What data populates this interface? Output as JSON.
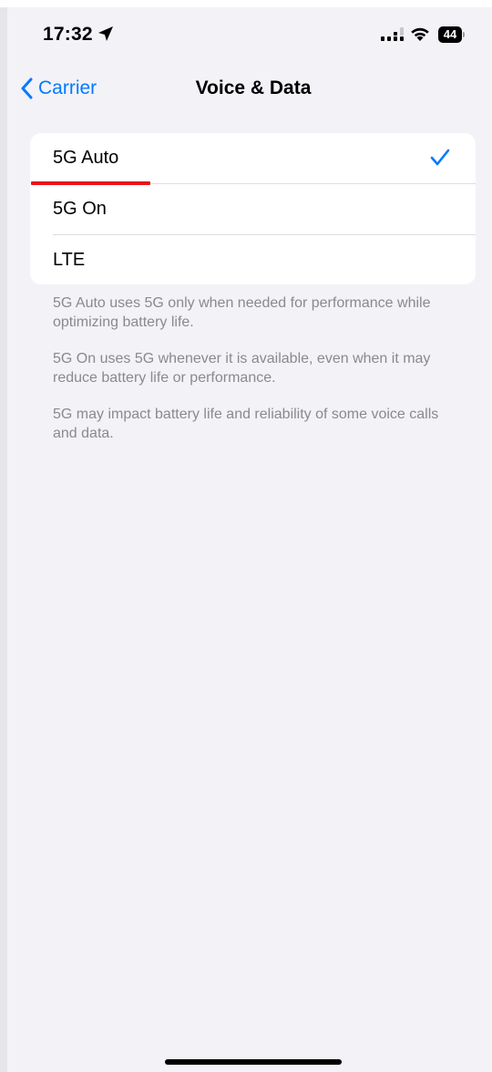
{
  "status_bar": {
    "time": "17:32",
    "battery": "44",
    "icons": [
      "location-arrow-icon",
      "cellular-signal-icon",
      "wifi-icon",
      "battery-icon"
    ]
  },
  "nav": {
    "back_label": "Carrier",
    "title": "Voice & Data"
  },
  "options": [
    {
      "label": "5G Auto",
      "selected": true
    },
    {
      "label": "5G On",
      "selected": false
    },
    {
      "label": "LTE",
      "selected": false
    }
  ],
  "notes": [
    "5G Auto uses 5G only when needed for performance while optimizing battery life.",
    "5G On uses 5G whenever it is available, even when it may reduce battery life or performance.",
    "5G may impact battery life and reliability of some voice calls and data."
  ],
  "colors": {
    "accent": "#007aff",
    "background": "#f2f2f7",
    "annotation_underline": "#e8141b"
  }
}
